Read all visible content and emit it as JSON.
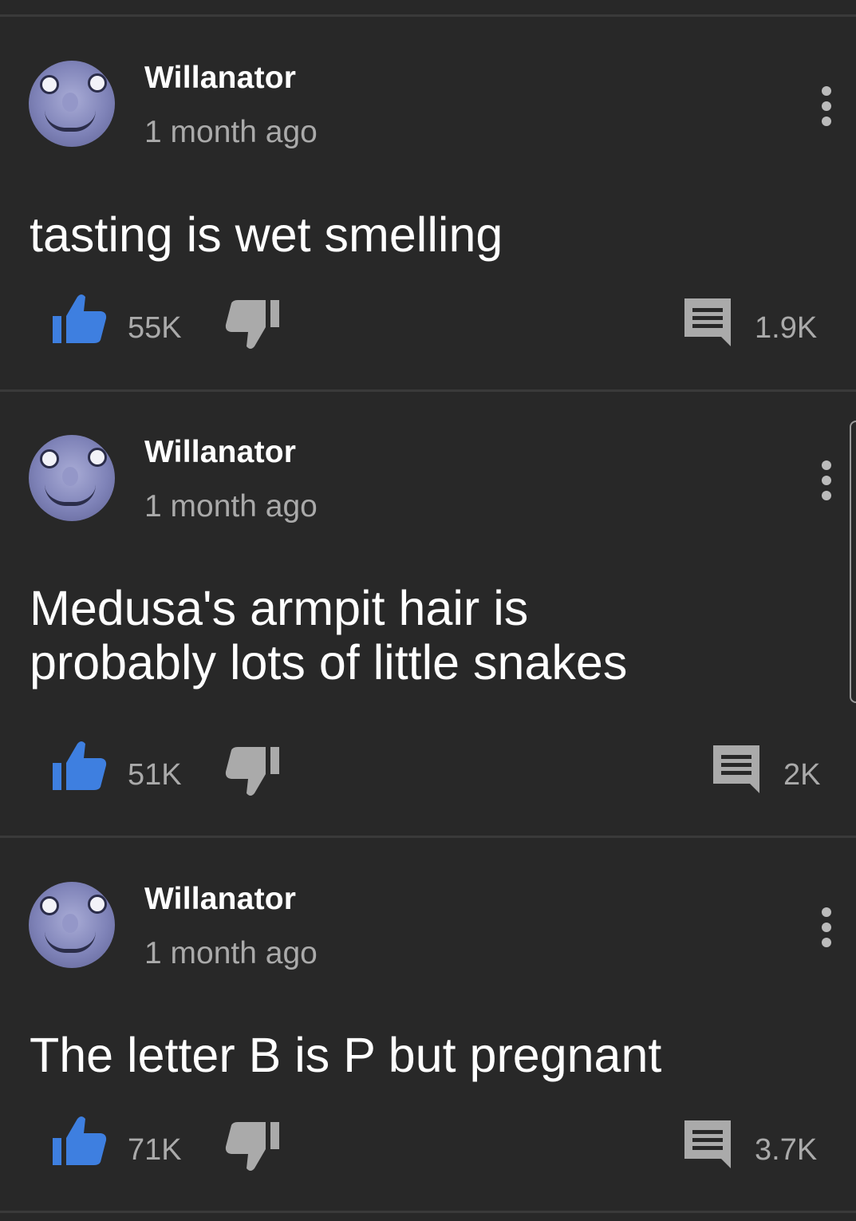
{
  "comments": [
    {
      "author": "Willanator",
      "time": "1 month ago",
      "lines": [
        "tasting is wet smelling"
      ],
      "likes": "55K",
      "replies": "1.9K"
    },
    {
      "author": "Willanator",
      "time": "1 month ago",
      "lines": [
        "Medusa's armpit hair is",
        "probably lots of little snakes"
      ],
      "likes": "51K",
      "replies": "2K"
    },
    {
      "author": "Willanator",
      "time": "1 month ago",
      "lines": [
        "The letter B is P but pregnant"
      ],
      "likes": "71K",
      "replies": "3.7K"
    }
  ],
  "colors": {
    "background": "#282828",
    "like_active": "#3e7fe0",
    "dislike": "#aaaaaa",
    "secondary_text": "#aaaaaa"
  },
  "icons": {
    "like": "thumbs-up-icon",
    "dislike": "thumbs-down-icon",
    "reply": "comment-icon",
    "menu": "more-vertical-icon"
  }
}
